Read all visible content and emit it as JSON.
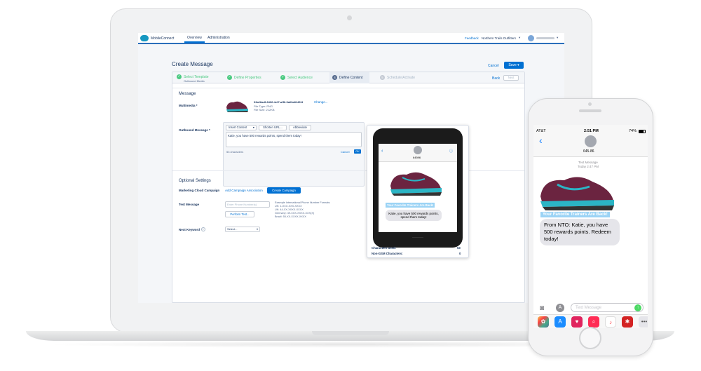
{
  "header": {
    "app_name": "MobileConnect",
    "tabs": [
      "Overview",
      "Administration"
    ],
    "feedback": "Feedback",
    "account": "Northern Trails Outfitters"
  },
  "page": {
    "title": "Create Message",
    "cancel": "Cancel",
    "save": "Save"
  },
  "path": {
    "steps": [
      {
        "label": "Select Template",
        "sub": "Outbound Media",
        "state": "done"
      },
      {
        "label": "Define Properties",
        "state": "done"
      },
      {
        "label": "Select Audience",
        "state": "done"
      },
      {
        "label": "Define Content",
        "state": "current",
        "num": "4"
      },
      {
        "label": "Schedule/Activate",
        "state": "todo",
        "num": "5"
      }
    ],
    "back": "Back",
    "next": "Next"
  },
  "message": {
    "section": "Message",
    "multimedia_label": "Multimedia *",
    "file_name": "93a26adf-6406-4ef7-aff6-9a63a8149f4",
    "change": "Change...",
    "file_type": "File Type: PNG",
    "file_size": "File Size: 212KB",
    "outbound_label": "Outbound Message *",
    "insert_content": "Insert Content",
    "shorten_url": "Shorten URL...",
    "abbreviate": "Abbreviate",
    "text": "Katie, you have 500 rewards points, spend them today!",
    "chars": "53 characters",
    "cancel": "Cancel",
    "ok": "OK"
  },
  "optional": {
    "section": "Optional Settings",
    "mc_label": "Marketing Cloud Campaign",
    "add_assoc": "Add Campaign Association",
    "create_campaign": "Create Campaign",
    "test_label": "Test Message",
    "phone_placeholder": "Enter Phone Number(s)",
    "perform_test": "Perform Test...",
    "formats": [
      "Example International Phone Number Formats:",
      "US: 1-XXX-XXX-XXXX",
      "UK: 44-XX-XXXX-XXXX",
      "Germany: 49-XXX-XXXX-XXX(X)",
      "Brazil: 55-XX-XXXX-XXXX"
    ],
    "keyword_label": "Next Keyword",
    "select": "Select..."
  },
  "preview": {
    "contact": "64596",
    "banner": "Your Favorite Trainers Are Back!",
    "bubble": "Katie, you have 500 rewards points, spend them today!",
    "chars_label": "Characters used:",
    "chars_value": "53",
    "nongsm_label": "Non-GSM Characters:",
    "nongsm_value": "0"
  },
  "phone": {
    "carrier": "AT&T",
    "time": "2:51 PM",
    "battery": "74%",
    "contact": "645-86",
    "meta1": "Text Message",
    "meta2": "Today 2:47 PM",
    "banner": "Your Favorite Trainers Are Back!",
    "bubble": "From NTO: Katie, you have 500 rewards points. Redeem today!",
    "input_placeholder": "Text Message"
  },
  "colors": {
    "brand": "#0070d2",
    "success": "#4bca81",
    "shoe": "#6b2440",
    "shoe_accent": "#2bb5c5",
    "bubble": "#e5e5ea",
    "highlight": "#9bd3f5"
  }
}
